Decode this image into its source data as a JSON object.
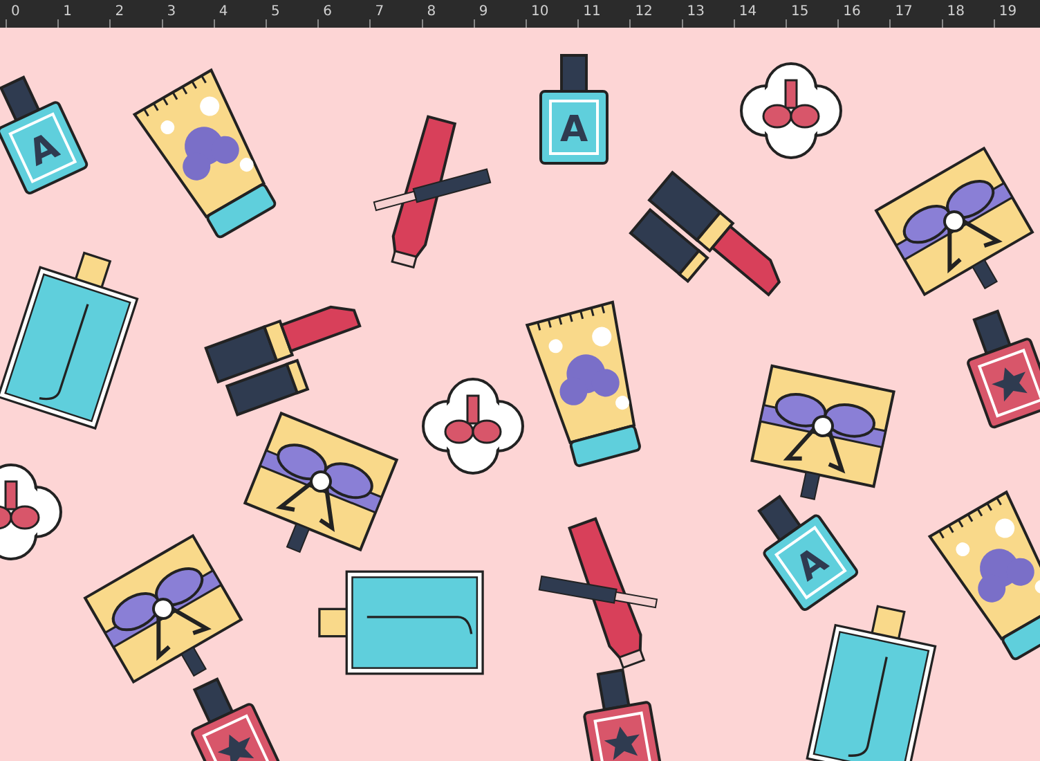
{
  "ruler": {
    "labels": [
      "0",
      "1",
      "2",
      "3",
      "4",
      "5",
      "6",
      "7",
      "8",
      "9",
      "10",
      "11",
      "12",
      "13",
      "14",
      "15",
      "16",
      "17",
      "18",
      "19"
    ]
  },
  "canvas": {
    "bottle_labels": [
      "A",
      "A",
      "A"
    ]
  }
}
